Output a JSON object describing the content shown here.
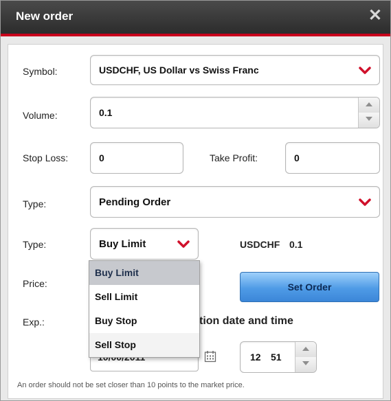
{
  "window": {
    "title": "New order",
    "close_glyph": "✕"
  },
  "form": {
    "symbol": {
      "label": "Symbol:",
      "value": "USDCHF, US Dollar vs Swiss Franc"
    },
    "volume": {
      "label": "Volume:",
      "value": "0.1"
    },
    "stop_loss": {
      "label": "Stop Loss:",
      "value": "0"
    },
    "take_profit": {
      "label": "Take Profit:",
      "value": "0"
    },
    "order_type": {
      "label": "Type:",
      "value": "Pending Order"
    },
    "pending_type": {
      "label": "Type:",
      "value": "Buy Limit"
    },
    "summary": {
      "symbol": "USDCHF",
      "volume": "0.1"
    },
    "price": {
      "label": "Price:"
    },
    "set_order_button": "Set Order",
    "expiration": {
      "label": "Exp.:",
      "visible_text": "tion date and time",
      "date_partial": "10/00/2011",
      "hour": "12",
      "minute": "51"
    },
    "note": "An order should not be set closer than 10 points to the market price."
  },
  "dropdown": {
    "options": [
      "Buy Limit",
      "Sell Limit",
      "Buy Stop",
      "Sell Stop"
    ],
    "selected": "Buy Limit"
  },
  "colors": {
    "accent_red": "#c8001c",
    "button_blue": "#4f9be6",
    "title_bg": "#333333"
  },
  "icons": {
    "chevron": "red-chevron-down-icon",
    "calendar": "calendar-icon",
    "close": "close-icon"
  }
}
